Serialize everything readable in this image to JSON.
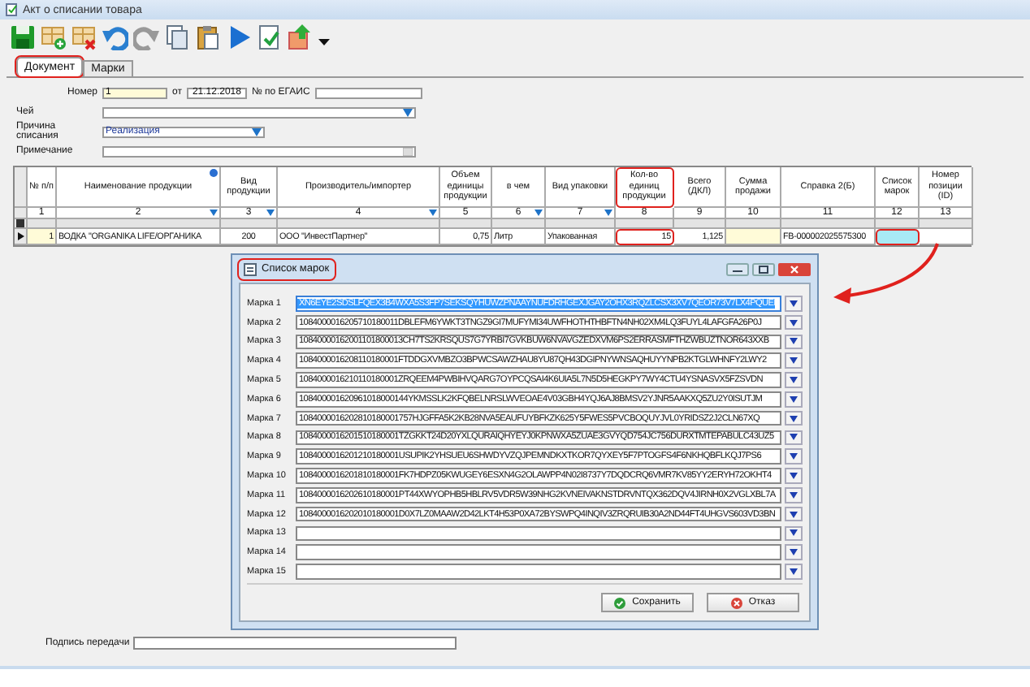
{
  "window": {
    "title": "Акт о списании товара"
  },
  "tabs": [
    {
      "label": "Документ",
      "selected": true,
      "annotated": true
    },
    {
      "label": "Марки",
      "selected": false,
      "annotated": false
    }
  ],
  "form": {
    "number_label": "Номер",
    "number": "1",
    "date_label": "от",
    "date": "21.12.2018",
    "egais_label": "№ по ЕГАИС",
    "owner_label": "Чей",
    "reason_label": "Причина списания",
    "reason": "Реализация",
    "note_label": "Примечание"
  },
  "grid": {
    "columns": [
      {
        "title": "№ п/п",
        "number": "1",
        "annotated": false
      },
      {
        "title": "Наименование продукции",
        "number": "2",
        "filter": true,
        "annotated": false
      },
      {
        "title": "Вид продукции",
        "number": "3",
        "filter": true,
        "annotated": false
      },
      {
        "title": "Производитель/импортер",
        "number": "4",
        "filter": true,
        "annotated": false
      },
      {
        "title": "Объем единицы продукции",
        "number": "5",
        "annotated": false
      },
      {
        "title": "в чем",
        "number": "6",
        "filter": true,
        "annotated": false
      },
      {
        "title": "Вид упаковки",
        "number": "7",
        "filter": true,
        "annotated": false
      },
      {
        "title": "Кол-во единиц продукции",
        "number": "8",
        "annotated": true
      },
      {
        "title": "Всего (ДКЛ)",
        "number": "9",
        "annotated": false
      },
      {
        "title": "Сумма продажи",
        "number": "10",
        "annotated": false
      },
      {
        "title": "Справка 2(Б)",
        "number": "11",
        "annotated": false
      },
      {
        "title": "Список марок",
        "number": "12",
        "annotated": false
      },
      {
        "title": "Номер позиции (ID)",
        "number": "13",
        "annotated": false
      }
    ],
    "rows": [
      {
        "current": true,
        "cells": [
          {
            "text": "1",
            "selected": false,
            "annotated": false
          },
          {
            "text": "ВОДКА \"ORGANIKA LIFE/ОРГАНИКА",
            "selected": false,
            "annotated": false
          },
          {
            "text": "200",
            "selected": false,
            "annotated": false
          },
          {
            "text": "ООО \"ИнвестПартнер\"",
            "selected": false,
            "annotated": false
          },
          {
            "text": "0,75",
            "selected": false,
            "annotated": false
          },
          {
            "text": "Литр",
            "selected": false,
            "annotated": false
          },
          {
            "text": "Упакованная",
            "selected": false,
            "annotated": false
          },
          {
            "text": "15",
            "selected": false,
            "annotated": true
          },
          {
            "text": "1,125",
            "selected": false,
            "annotated": false
          },
          {
            "selected": false,
            "annotated": false
          },
          {
            "text": "FB-000002025575300",
            "selected": false,
            "annotated": false
          },
          {
            "selected": true,
            "annotated": true
          },
          {
            "selected": false,
            "annotated": false
          }
        ]
      }
    ]
  },
  "signature_label": "Подпись передачи",
  "annotation_arrow": true,
  "dialog": {
    "title": "Список марок",
    "annotated": true,
    "marks": [
      {
        "label": "Марка 1",
        "code": "XN6EYE2SDSLFQEX3B4WXA5S3FP7SEKSQYHUWZPNAAYNUFDRHGEXJGAY2OHX3RQZLCSX3XV7QEOR73V7LX4PQUEI",
        "selected": true
      },
      {
        "label": "Марка 2",
        "code": "1084000016205710180011DBLEFM6YWKT3TNGZ9GI7MUFYMI34UWFHOTHTHBFTN4NH02XM4LQ3FUYL4LAFGFA26P0J",
        "selected": false
      },
      {
        "label": "Марка 3",
        "code": "10840000162001101800013CH7TS2KRSQUS7G7YRBI7GVKBUW6NVAVGZEDXVM6PS2ERRASMFTHZWBUZTNOR643XXB",
        "selected": false
      },
      {
        "label": "Марка 4",
        "code": "1084000016208110180001FTDDGXVMBZO3BPWCSAWZHAU8YU87QH43DGIPNYWNSAQHUYYNPB2KTGLWHNFY2LWY2",
        "selected": false
      },
      {
        "label": "Марка 5",
        "code": "1084000016210110180001ZRQEEM4PWBIHVQARG7OYPCQSAI4K6UIA5L7N5D5HEGKPY7WY4CTU4YSNASVX5FZSVDN",
        "selected": false
      },
      {
        "label": "Марка 6",
        "code": "108400001620961018000144YKMSSLK2KFQBELNRSLWVEOAE4V03GBH4YQJ6AJ8BMSV2YJNR5AAKXQ5ZU2Y0ISUTJM",
        "selected": false
      },
      {
        "label": "Марка 7",
        "code": "1084000016202810180001757HJGFFA5K2KB28NVA5EAUFUYBFKZK625Y5FWES5PVCBOQUYJVL0YRIDSZ2J2CLN67XQ",
        "selected": false
      },
      {
        "label": "Марка 8",
        "code": "1084000016201510180001TZGKKT24D20YXLQURAIQHYEYJ0KPNWXA5ZUAE3GVYQD754JC756DURXTMTEPABULC43UZ5",
        "selected": false
      },
      {
        "label": "Марка 9",
        "code": "1084000016201210180001USUPIK2YHSUEU6SHWDYVZQJPEMNDKXTKOR7QYXEY5F7PTOGFS4F6NKHQBFLKQJ7PS6",
        "selected": false
      },
      {
        "label": "Марка 10",
        "code": "1084000016201810180001FK7HDPZ05KWUGEY6ESXN4G2OLAWPP4N02I8737Y7DQDCRQ6VMR7KV85YY2ERYH72OKHT4",
        "selected": false
      },
      {
        "label": "Марка 11",
        "code": "1084000016202610180001PT44XWYOPHB5HBLRV5VDR5W39NHG2KVNEIVAKNSTDRVNTQX362DQV4JIRNH0X2VGLXBL7A",
        "selected": false
      },
      {
        "label": "Марка 12",
        "code": "1084000016202010180001D0X7LZ0MAAW2D42LKT4H53P0XA72BYSWPQ4INQIV3ZRQRUIB30A2ND44FT4UHGVS603VD3BN",
        "selected": false
      },
      {
        "label": "Марка 13",
        "selected": false
      },
      {
        "label": "Марка 14",
        "selected": false
      },
      {
        "label": "Марка 15",
        "selected": false
      }
    ],
    "buttons": [
      {
        "label": "Сохранить",
        "kind": "ok"
      },
      {
        "label": "Отказ",
        "kind": "cancel"
      }
    ]
  }
}
